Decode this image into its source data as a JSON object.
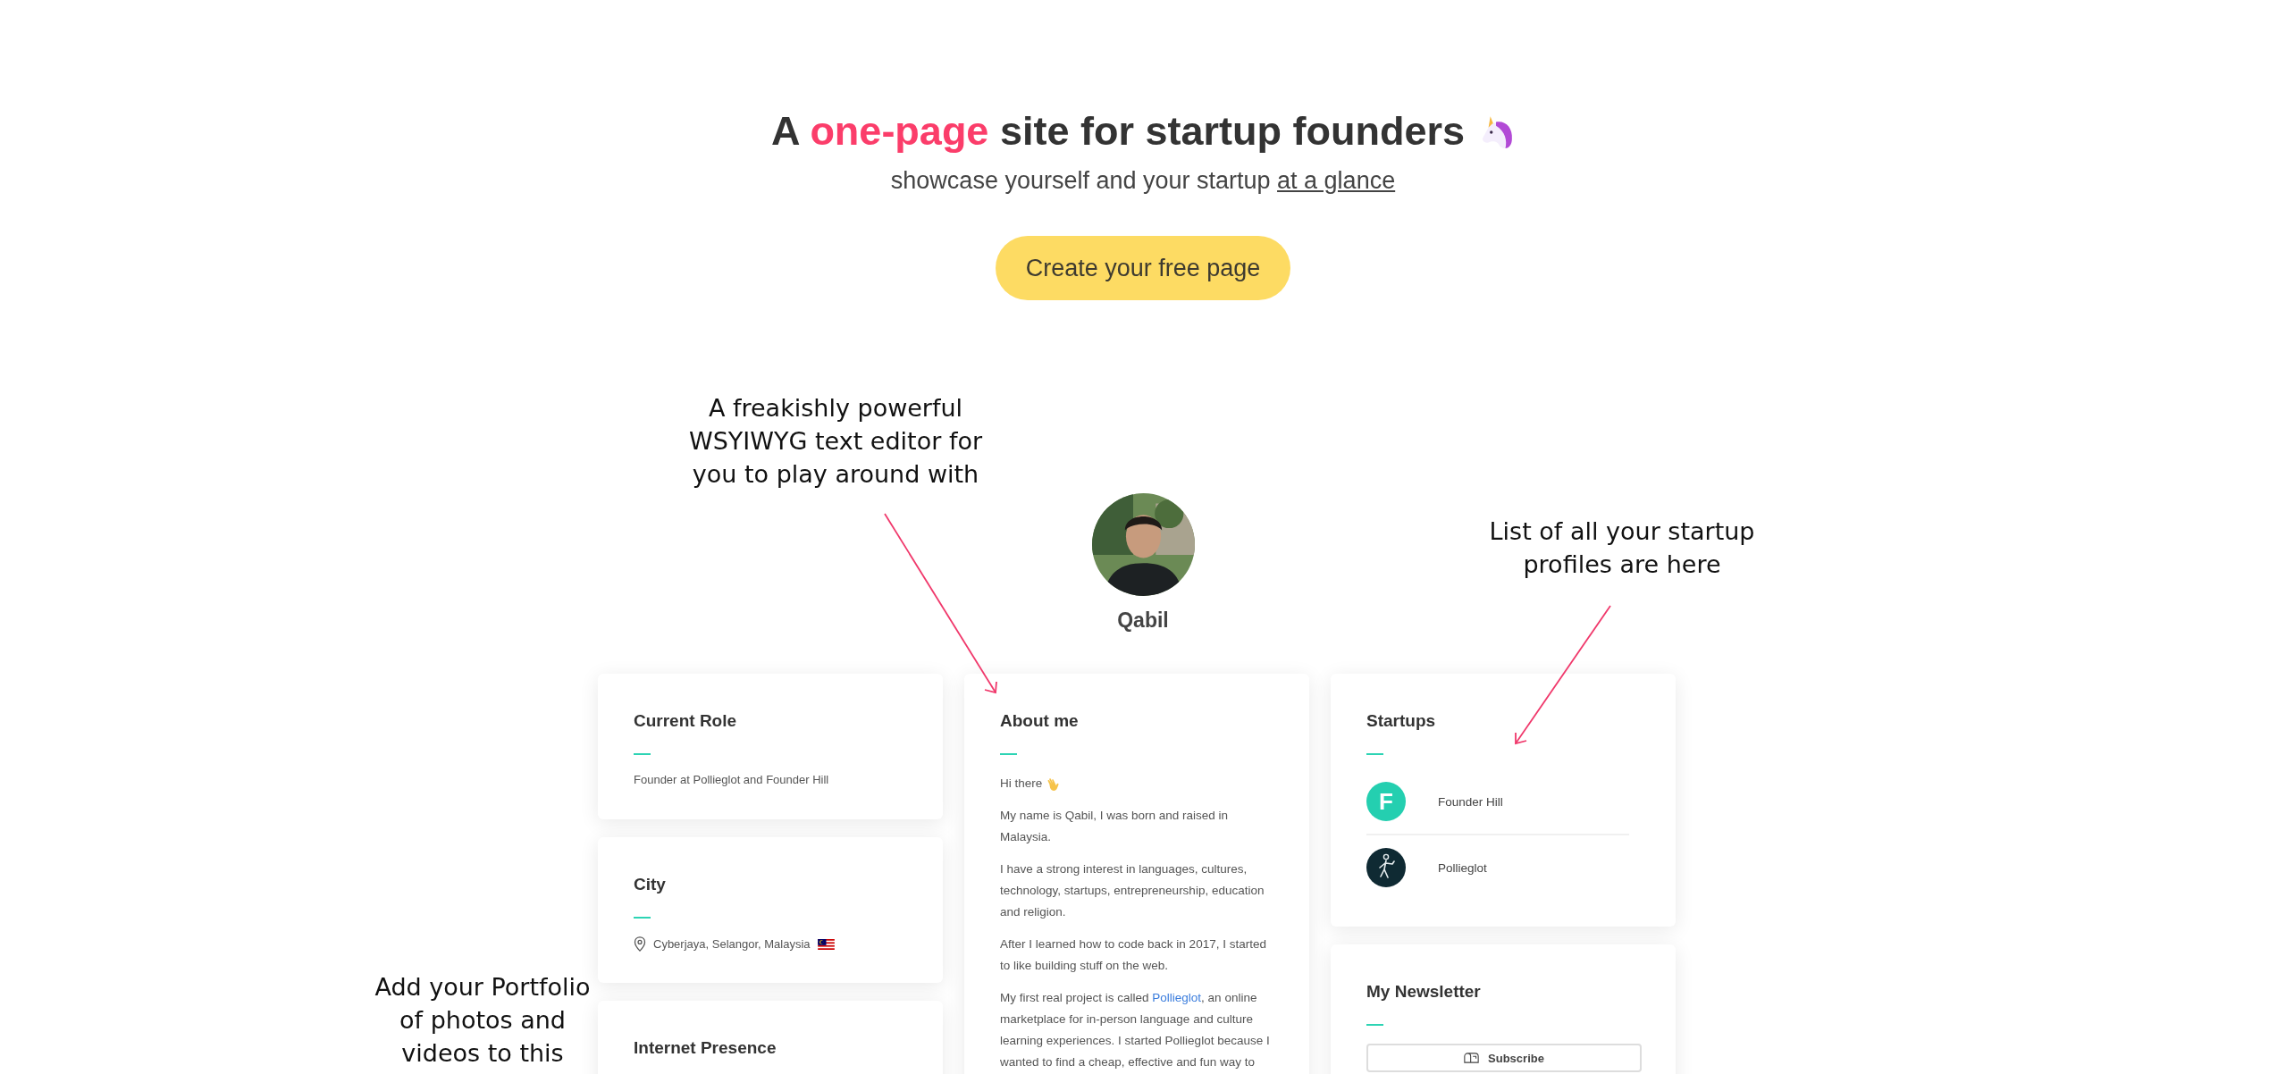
{
  "hero": {
    "title_before": "A",
    "title_highlight": "one-page",
    "title_after": "site for startup founders",
    "subtitle": "showcase yourself and your startup",
    "subtitle_link": "at a glance",
    "cta": "Create your free page"
  },
  "annotations": [
    {
      "text": "A freakishly powerful\nWSYIWYG text editor for\nyou to play around with",
      "kind": "editor"
    },
    {
      "text": "List of all your startup\nprofiles are here",
      "kind": "startups"
    },
    {
      "text": "Add your Portfolio\nof photos and\nvideos to this",
      "kind": "portfolio"
    }
  ],
  "profile": {
    "name": "Qabil"
  },
  "left_cards": [
    {
      "title": "Current Role",
      "kind": "text",
      "body": "Founder at Pollieglot and Founder Hill"
    },
    {
      "title": "City",
      "kind": "location",
      "body": "Cyberjaya, Selangor, Malaysia"
    },
    {
      "title": "Internet Presence",
      "kind": "empty"
    }
  ],
  "about": {
    "title": "About me",
    "greeting": "Hi there",
    "paragraphs": [
      [
        {
          "text": "My name is Qabil, I was born and raised in Malaysia.",
          "kind": "text"
        }
      ],
      [
        {
          "text": "I have a strong interest in languages, cultures, technology, startups, entrepreneurship, education and religion.",
          "kind": "text"
        }
      ],
      [
        {
          "text": "After I learned how to code back in 2017, I started to like building stuff on the web.",
          "kind": "text"
        }
      ],
      [
        {
          "text": "My first real project is called ",
          "kind": "text"
        },
        {
          "text": "Pollieglot",
          "kind": "link"
        },
        {
          "text": ", an online marketplace for in-person language and culture learning experiences. I started Pollieglot because I wanted to find a cheap, effective and fun way to",
          "kind": "text"
        }
      ]
    ]
  },
  "startups": {
    "title": "Startups",
    "items": [
      {
        "name": "Founder Hill",
        "kind": "letter",
        "letter": "F",
        "color": "#24cfb0"
      },
      {
        "name": "Pollieglot",
        "kind": "figure",
        "color": "#0f2a33"
      }
    ]
  },
  "newsletter": {
    "title": "My Newsletter",
    "button": "Subscribe"
  }
}
